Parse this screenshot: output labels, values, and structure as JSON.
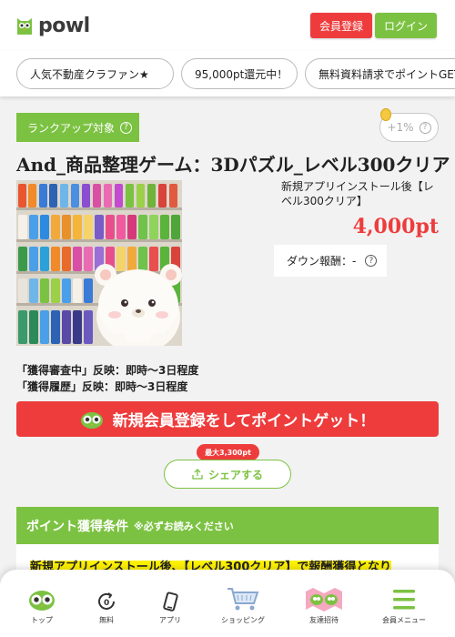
{
  "header": {
    "logo_text": "powl",
    "register_label": "会員登録",
    "login_label": "ログイン"
  },
  "chips": [
    {
      "label": "人気不動産クラファン★"
    },
    {
      "label": "95,000pt還元中！"
    },
    {
      "label": "無料資料請求でポイントGET"
    }
  ],
  "offer": {
    "rankup_label": "ランクアップ対象",
    "bonus_label": "+1%",
    "title": "And_商品整理ゲーム：3Dパズル_レベル300クリア",
    "condition": "新規アプリインストール後【レベル300クリア】",
    "points": "4,000pt",
    "down_reward": "ダウン報酬：-",
    "reflect_pending": "「獲得審査中」反映：即時～3日程度",
    "reflect_history": "「獲得履歴」反映：即時～3日程度",
    "cta_label": "新規会員登録をしてポイントゲット！",
    "share_badge": "最大3,300pt",
    "share_label": "シェアする"
  },
  "conditions": {
    "header": "ポイント獲得条件",
    "note": "※必ずお読みください",
    "body": "新規アプリインストール後、【レベル300クリア】で報酬獲得となり"
  },
  "bottom_nav": [
    {
      "label": "トップ",
      "icon": "owl-icon"
    },
    {
      "label": "無料",
      "icon": "free-icon"
    },
    {
      "label": "アプリ",
      "icon": "smartphone-icon"
    },
    {
      "label": "ショッピング",
      "icon": "cart-icon"
    },
    {
      "label": "友達招待",
      "icon": "invite-icon"
    },
    {
      "label": "会員メニュー",
      "icon": "menu-icon"
    }
  ],
  "colors": {
    "accent_red": "#ee3c3c",
    "accent_green": "#7cc242",
    "highlight_yellow": "#fff200"
  }
}
